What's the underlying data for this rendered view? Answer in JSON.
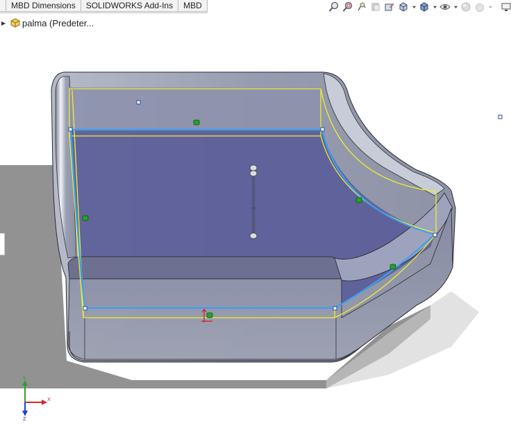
{
  "command_manager": {
    "tabs": [
      {
        "label": "MBD Dimensions"
      },
      {
        "label": "SOLIDWORKS Add-Ins"
      },
      {
        "label": "MBD"
      }
    ]
  },
  "heads_up_toolbar": {
    "icons": [
      "zoom-to-fit-icon",
      "zoom-to-area-icon",
      "previous-view-icon",
      "section-view-icon",
      "dynamic-annotation-icon",
      "view-orientation-icon",
      "display-style-icon",
      "hide-show-items-icon",
      "edit-appearance-icon",
      "apply-scene-icon",
      "view-settings-icon",
      "display-pane-icon"
    ]
  },
  "feature_tree": {
    "root_label": "palma  (Predeter..."
  },
  "triad": {
    "x_label": "X",
    "y_label": "Y",
    "z_label": "Z"
  },
  "colors": {
    "selection_blue": "#3aa0f2",
    "preview_yellow": "#f2ee2a",
    "face_fill": "#5b5d99",
    "shell_gray": "#8f95a8",
    "shadow_gray": "#8a8a8a",
    "handle_green": "#23a32a"
  }
}
